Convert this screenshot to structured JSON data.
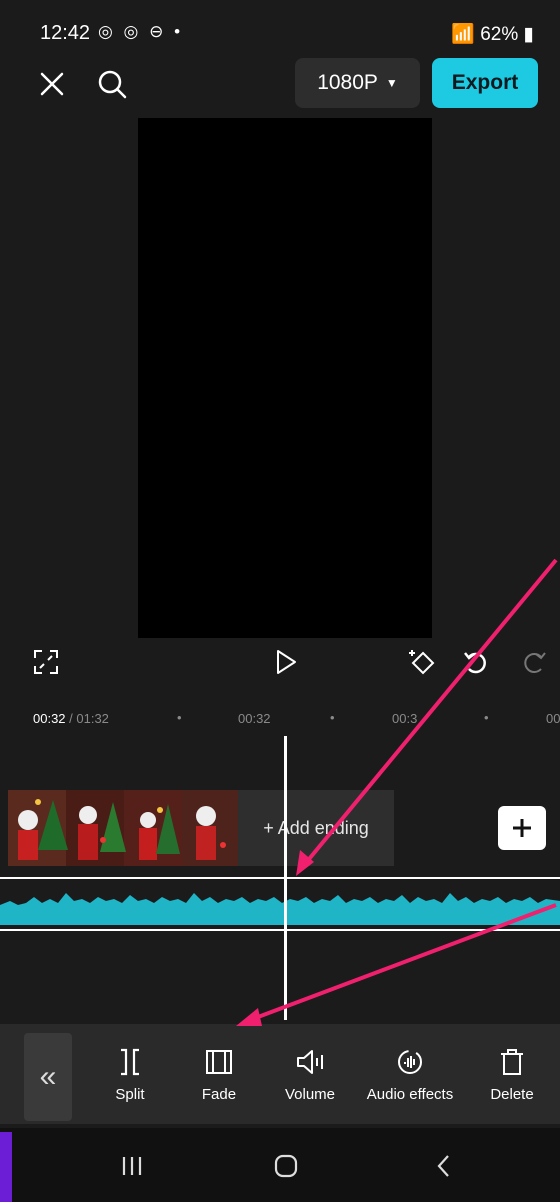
{
  "status_bar": {
    "time": "12:42",
    "left_icons": "◎ ◎ ⊖ •",
    "right": "62%"
  },
  "top_bar": {
    "close_icon": "close-icon",
    "search_icon": "search-icon",
    "resolution": "1080P",
    "export_label": "Export"
  },
  "timeline": {
    "current_time": "00:32",
    "total_time": " / 01:32",
    "tick_1": "00:32",
    "tick_2": "00:3",
    "tick_3": "00",
    "add_ending_label": "+ Add ending"
  },
  "toolbar": {
    "split": "Split",
    "fade": "Fade",
    "volume": "Volume",
    "audio_effects": "Audio effects",
    "delete": "Delete"
  },
  "colors": {
    "accent": "#1ec9e2",
    "waveform": "#1fb5c7",
    "annotation_arrow": "#f0206e"
  }
}
